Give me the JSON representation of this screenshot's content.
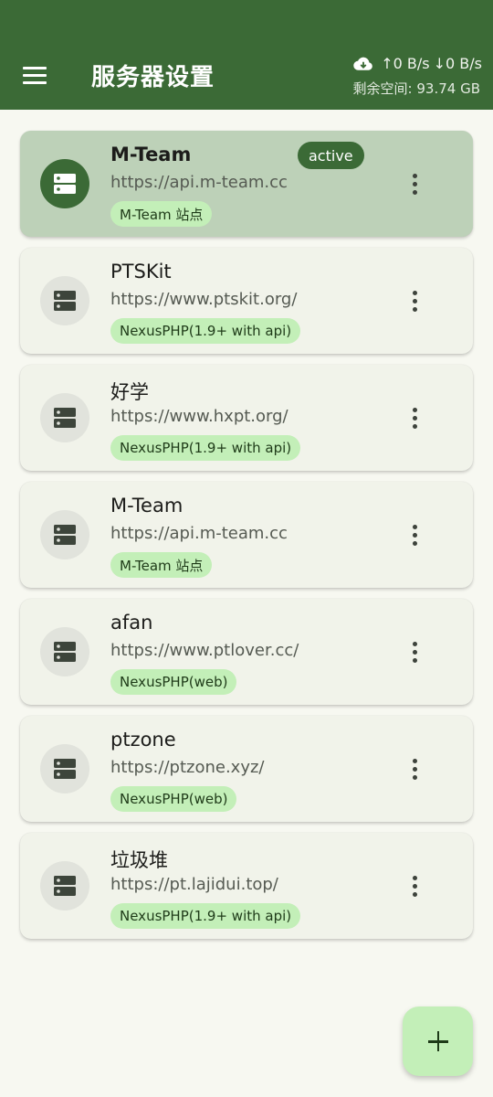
{
  "header": {
    "title": "服务器设置",
    "upload_speed": "↑0 B/s",
    "download_speed": "↓0 B/s",
    "storage": "剩余空间: 93.74 GB"
  },
  "colors": {
    "primary": "#3b6a36",
    "tag_bg": "#c3efb8",
    "active_card_bg": "#bdd1b8",
    "card_bg": "#f1f3ea",
    "page_bg": "#f7f8f1"
  },
  "servers": [
    {
      "name": "M-Team",
      "url": "https://api.m-team.cc",
      "tag": "M-Team 站点",
      "badge": "active",
      "active": true
    },
    {
      "name": "PTSKit",
      "url": "https://www.ptskit.org/",
      "tag": "NexusPHP(1.9+ with api)"
    },
    {
      "name": "好学",
      "url": "https://www.hxpt.org/",
      "tag": "NexusPHP(1.9+ with api)"
    },
    {
      "name": "M-Team",
      "url": "https://api.m-team.cc",
      "tag": "M-Team 站点"
    },
    {
      "name": "afan",
      "url": "https://www.ptlover.cc/",
      "tag": "NexusPHP(web)"
    },
    {
      "name": "ptzone",
      "url": "https://ptzone.xyz/",
      "tag": "NexusPHP(web)"
    },
    {
      "name": "垃圾堆",
      "url": "https://pt.lajidui.top/",
      "tag": "NexusPHP(1.9+ with api)"
    }
  ],
  "icons": {
    "menu": "menu-icon",
    "cloud": "cloud-download-icon",
    "server": "server-icon",
    "more": "more-vert-icon",
    "add": "add-icon"
  }
}
